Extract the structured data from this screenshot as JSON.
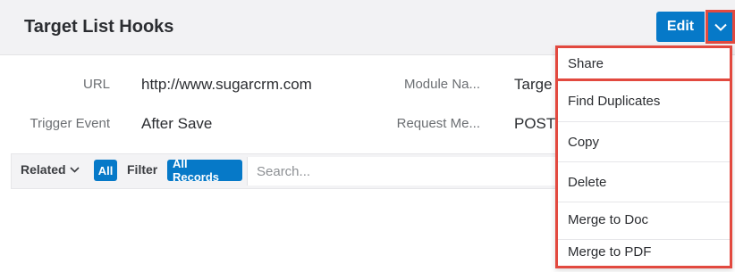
{
  "header": {
    "title": "Target List Hooks",
    "edit_label": "Edit",
    "actions_icon": "chevron-down-icon"
  },
  "fields": [
    {
      "label": "URL",
      "value": "http://www.sugarcrm.com"
    },
    {
      "label": "Module Na...",
      "value": "Targe"
    },
    {
      "label": "Trigger Event",
      "value": "After Save"
    },
    {
      "label": "Request Me...",
      "value": "POST"
    }
  ],
  "subpanel_bar": {
    "related_label": "Related",
    "related_pill": "All",
    "filter_label": "Filter",
    "filter_pill": "All Records",
    "search_placeholder": "Search..."
  },
  "dropdown_menu": {
    "items": [
      "Share",
      "Find Duplicates",
      "Copy",
      "Delete",
      "Merge to Doc",
      "Merge to PDF"
    ]
  },
  "colors": {
    "primary_blue": "#0679c8",
    "highlight_red": "#e2493f",
    "header_bg": "#f2f2f4"
  }
}
